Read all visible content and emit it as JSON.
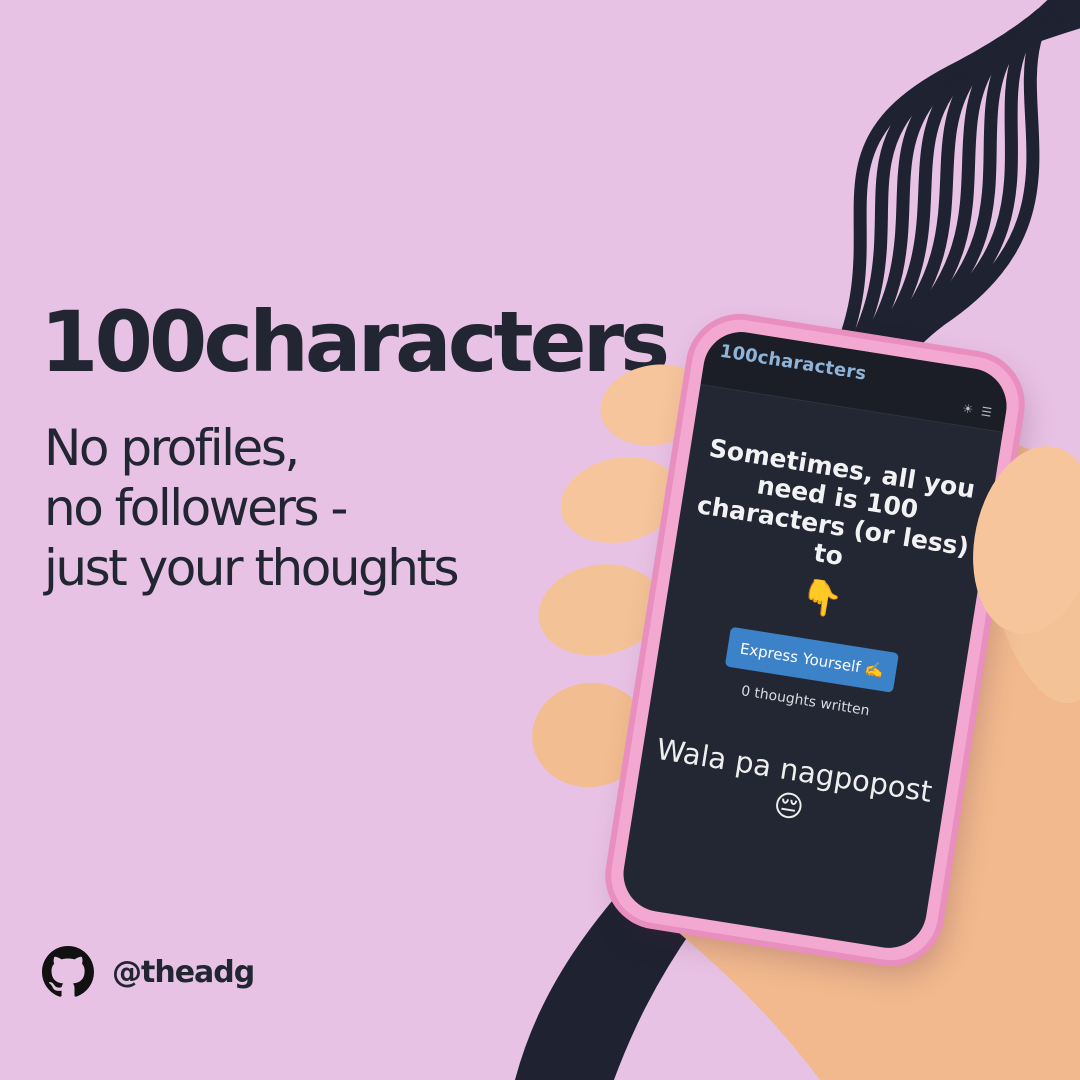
{
  "headline": "100characters",
  "tagline": [
    "No profiles,",
    "no followers -",
    "just your thoughts"
  ],
  "social": {
    "icon": "github-icon",
    "handle": "@theadg"
  },
  "phone": {
    "app_title": "100characters",
    "toolbar_icons": [
      "sun-icon",
      "menu-icon"
    ],
    "hero_text": "Sometimes, all you need is 100 characters (or less) to",
    "pointing_emoji": "👇",
    "cta_label": "Express Yourself ✍️",
    "thoughts_count": "0 thoughts written",
    "empty_state": "Wala pa nagpopost 😔"
  },
  "colors": {
    "background": "#e8c2e4",
    "text_dark": "#222633",
    "phone_case": "#f3a8d2",
    "screen": "#232733",
    "cta": "#3b82c8",
    "app_title": "#8fb4d8"
  }
}
